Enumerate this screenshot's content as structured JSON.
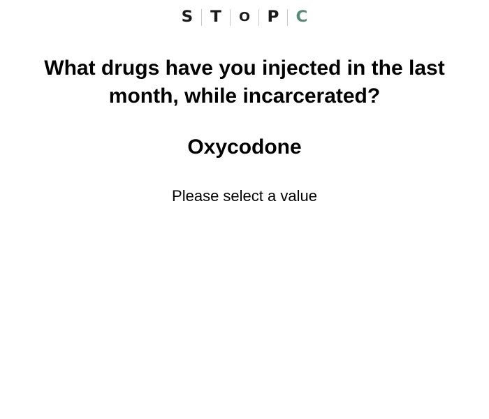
{
  "logo": {
    "letters": [
      "S",
      "T",
      "O",
      "P",
      "C"
    ],
    "colors": {
      "default": "#1a1a1a",
      "accent": "#5a8a7a"
    }
  },
  "question": {
    "text": "What drugs have you injected in the last month, while incarcerated?"
  },
  "option": {
    "label": "Oxycodone"
  },
  "prompt": {
    "text": "Please select a value"
  }
}
